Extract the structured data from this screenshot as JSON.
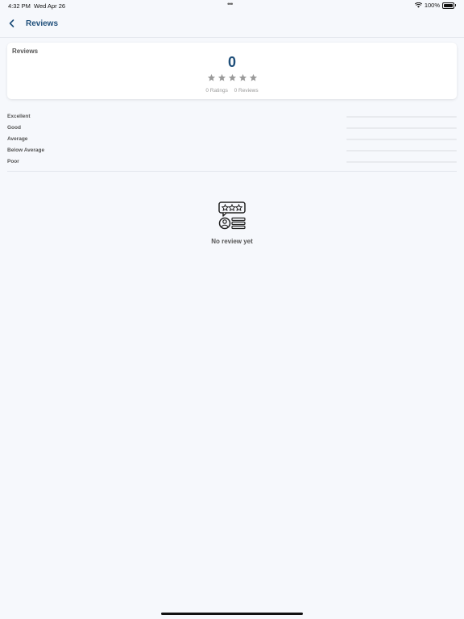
{
  "status_bar": {
    "time": "4:32 PM",
    "date": "Wed Apr 26",
    "dots": "•••",
    "battery": "100%"
  },
  "nav": {
    "title": "Reviews",
    "back_icon": "chevron-left-icon"
  },
  "summary": {
    "title": "Reviews",
    "average": "0",
    "ratings_text": "0 Ratings",
    "reviews_text": "0 Reviews",
    "stars_filled": 0,
    "stars_total": 5
  },
  "breakdown": [
    {
      "label": "Excellent",
      "fraction": 0
    },
    {
      "label": "Good",
      "fraction": 0
    },
    {
      "label": "Average",
      "fraction": 0
    },
    {
      "label": "Below Average",
      "fraction": 0
    },
    {
      "label": "Poor",
      "fraction": 0
    }
  ],
  "empty_state": {
    "icon": "review-feedback-icon",
    "text": "No review yet"
  },
  "colors": {
    "accent": "#1f4f7a",
    "star_empty": "#9a9a9a",
    "background": "#f6f8fc"
  }
}
